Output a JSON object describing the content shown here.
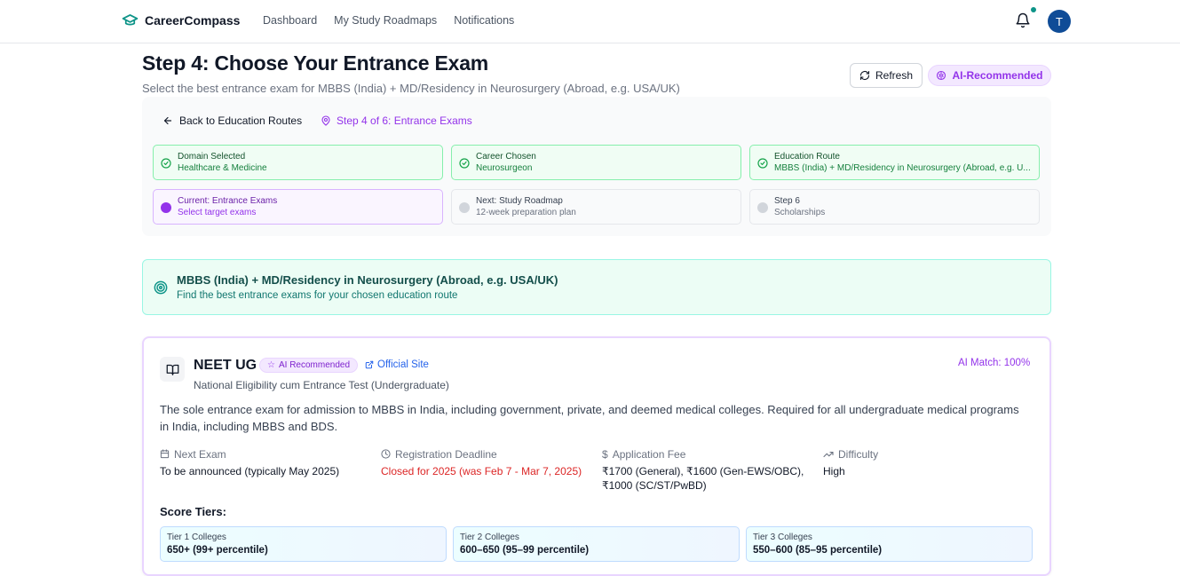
{
  "brand": {
    "name": "CareerCompass",
    "icon": "graduation-cap-icon",
    "color": "#0d9488"
  },
  "nav": {
    "items": [
      "Dashboard",
      "My Study Roadmaps",
      "Notifications"
    ]
  },
  "user": {
    "initial": "T"
  },
  "header": {
    "title": "Step 4: Choose Your Entrance Exam",
    "subtitle": "Select the best entrance exam for MBBS (India) + MD/Residency in Neurosurgery (Abroad, e.g. USA/UK)",
    "refresh_label": "Refresh",
    "ai_label": "AI-Recommended"
  },
  "progress": {
    "back_label": "Back to Education Routes",
    "step_label": "Step 4 of 6: Entrance Exams",
    "steps": [
      {
        "title": "Domain Selected",
        "sub": "Healthcare & Medicine",
        "state": "done"
      },
      {
        "title": "Career Chosen",
        "sub": "Neurosurgeon",
        "state": "done"
      },
      {
        "title": "Education Route",
        "sub": "MBBS (India) + MD/Residency in Neurosurgery (Abroad, e.g. U...",
        "state": "done"
      },
      {
        "title": "Current: Entrance Exams",
        "sub": "Select target exams",
        "state": "current"
      },
      {
        "title": "Next: Study Roadmap",
        "sub": "12-week preparation plan",
        "state": "pending"
      },
      {
        "title": "Step 6",
        "sub": "Scholarships",
        "state": "pending"
      }
    ]
  },
  "route": {
    "title": "MBBS (India) + MD/Residency in Neurosurgery (Abroad, e.g. USA/UK)",
    "subtitle": "Find the best entrance exams for your chosen education route"
  },
  "exam": {
    "name": "NEET UG",
    "badge": "AI Recommended",
    "official_label": "Official Site",
    "full_name": "National Eligibility cum Entrance Test (Undergraduate)",
    "ai_match": "AI Match: 100%",
    "description": "The sole entrance exam for admission to MBBS in India, including government, private, and deemed medical colleges. Required for all undergraduate medical programs in India, including MBBS and BDS.",
    "info": [
      {
        "label": "Next Exam",
        "icon": "calendar-icon",
        "value": "To be announced (typically May 2025)"
      },
      {
        "label": "Registration Deadline",
        "icon": "clock-icon",
        "value": "Closed for 2025 (was Feb 7 - Mar 7, 2025)"
      },
      {
        "label": "Application Fee",
        "icon": "dollar-icon",
        "value": "₹1700 (General), ₹1600 (Gen-EWS/OBC), ₹1000 (SC/ST/PwBD)"
      },
      {
        "label": "Difficulty",
        "icon": "trending-up-icon",
        "value": "High"
      }
    ],
    "tiers_title": "Score Tiers:",
    "tiers": [
      {
        "label": "Tier 1 Colleges",
        "value": "650+ (99+ percentile)"
      },
      {
        "label": "Tier 2 Colleges",
        "value": "600–650 (95–99 percentile)"
      },
      {
        "label": "Tier 3 Colleges",
        "value": "550–600 (85–95 percentile)"
      }
    ]
  }
}
